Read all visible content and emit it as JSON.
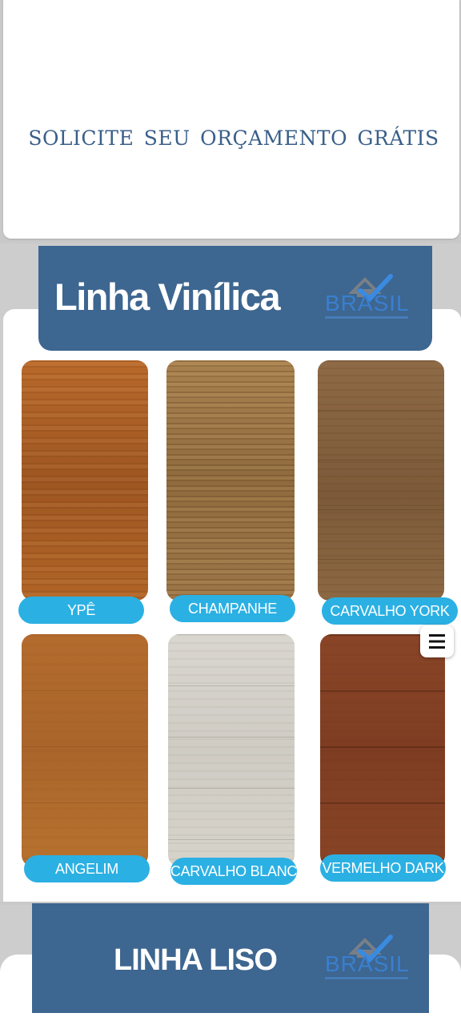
{
  "cta": {
    "text": "SOLICITE  SEU ORÇAMENTO GRÁTIS"
  },
  "section1": {
    "title": "Linha Vinílica",
    "logo_text": "BRASIL",
    "products": [
      {
        "label": "YPÊ"
      },
      {
        "label": "CHAMPANHE"
      },
      {
        "label": "CARVALHO YORK"
      },
      {
        "label": "ANGELIM"
      },
      {
        "label": "CARVALHO BLANC"
      },
      {
        "label": "VERMELHO DARK"
      }
    ]
  },
  "section2": {
    "title": "LINHA LISO",
    "logo_text": "BRASIL"
  },
  "icons": {
    "menu": "hamburger-menu-icon",
    "logo": "house-check-logo-icon"
  },
  "colors": {
    "brand_blue": "#3d6690",
    "label_cyan": "#2bb0e3",
    "cta_text": "#3a5f89",
    "logo_blue": "#3a7fd0"
  }
}
